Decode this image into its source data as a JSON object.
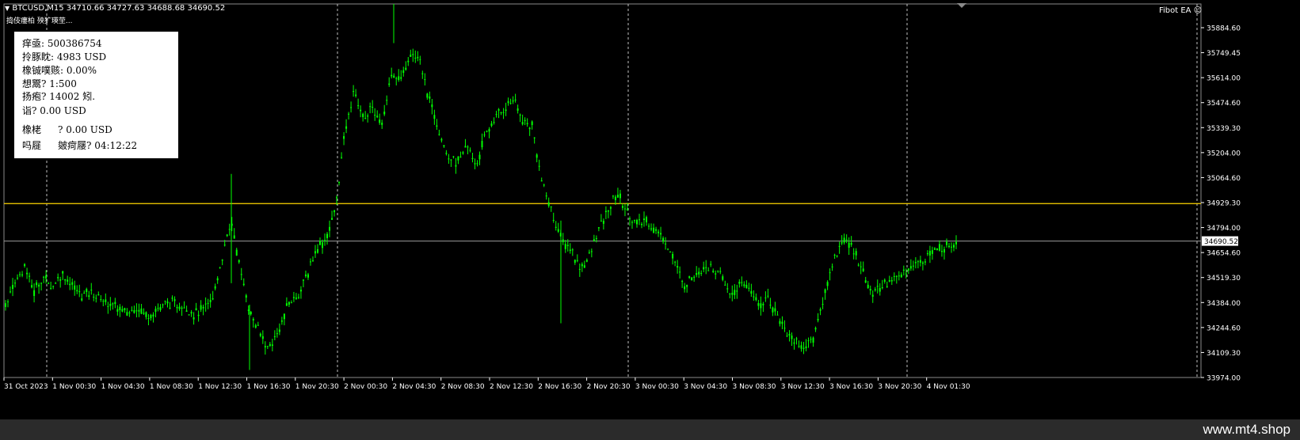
{
  "header": {
    "symbol_line": "BTCUSD,M15  34710.66 34727.63 34688.68 34690.52",
    "subtitle": "捣伎瘻柏 殃犷瑛茔...",
    "ea_label": "Fibot EA"
  },
  "info_panel": {
    "rows": [
      "痒亟: 500386754",
      "拎豚眈: 4983 USD",
      "橡铖噗赅: 0.00%",
      "想鬻? 1:500",
      "扬疱? 14002 矧.",
      "诣? 0.00 USD"
    ],
    "profit_label": "橡栳",
    "profit_value": "? 0.00 USD",
    "time_label": "吗屣",
    "time_value": "皴疴屦? 04:12:22"
  },
  "price_axis": {
    "labels": [
      "35884.60",
      "35749.45",
      "35614.00",
      "35474.60",
      "35339.30",
      "35204.00",
      "35064.60",
      "34929.30",
      "34794.00",
      "34654.60",
      "34519.30",
      "34384.00",
      "34244.60",
      "34109.30",
      "33974.00"
    ],
    "current_price": "34690.52"
  },
  "time_axis": {
    "labels": [
      "31 Oct 2023",
      "1 Nov 00:30",
      "1 Nov 04:30",
      "1 Nov 08:30",
      "1 Nov 12:30",
      "1 Nov 16:30",
      "1 Nov 20:30",
      "2 Nov 00:30",
      "2 Nov 04:30",
      "2 Nov 08:30",
      "2 Nov 12:30",
      "2 Nov 16:30",
      "2 Nov 20:30",
      "3 Nov 00:30",
      "3 Nov 04:30",
      "3 Nov 08:30",
      "3 Nov 12:30",
      "3 Nov 16:30",
      "3 Nov 20:30",
      "4 Nov 01:30"
    ]
  },
  "levels": {
    "yellow_level": 34891,
    "current_line": 34690.52
  },
  "price_series": [
    34350,
    34470,
    34560,
    34420,
    34500,
    34445,
    34520,
    34460,
    34400,
    34420,
    34380,
    34360,
    34330,
    34300,
    34340,
    34290,
    34320,
    34360,
    34350,
    34340,
    34300,
    34320,
    34380,
    34600,
    34800,
    34520,
    34300,
    34200,
    34120,
    34200,
    34350,
    34400,
    34500,
    34650,
    34700,
    34850,
    35250,
    35500,
    35350,
    35400,
    35300,
    35600,
    35550,
    35700,
    35650,
    35450,
    35300,
    35150,
    35100,
    35200,
    35100,
    35250,
    35350,
    35400,
    35450,
    35320,
    35300,
    35000,
    34850,
    34700,
    34650,
    34550,
    34600,
    34750,
    34850,
    34950,
    34850,
    34780,
    34800,
    34750,
    34700,
    34600,
    34450,
    34500,
    34550,
    34550,
    34500,
    34400,
    34450,
    34450,
    34350,
    34380,
    34300,
    34200,
    34150,
    34120,
    34200,
    34400,
    34600,
    34700,
    34650,
    34550,
    34400,
    34450,
    34480,
    34500,
    34550,
    34580,
    34620,
    34640,
    34660,
    34690
  ],
  "colors": {
    "candle": "#00ff00",
    "yellow_line": "#ffd700",
    "grid": "#c0c0c0",
    "axis_text": "#ffffff",
    "footer_bg": "#2b2b2b"
  },
  "footer": {
    "watermark": "www.mt4.shop"
  }
}
